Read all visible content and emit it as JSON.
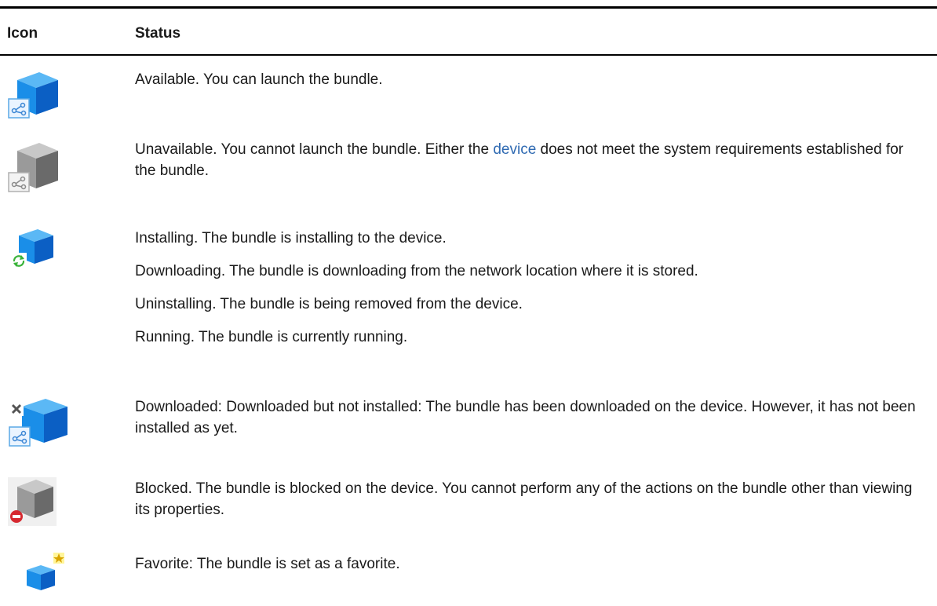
{
  "header": {
    "icon": "Icon",
    "status": "Status"
  },
  "rows": [
    {
      "icon": "blue-bundle-shortcut-icon",
      "lines": [
        "Available. You can launch the bundle."
      ]
    },
    {
      "icon": "gray-bundle-shortcut-icon",
      "lines": [
        "Unavailable. You cannot launch the bundle. Either the ",
        "device",
        " does not meet the system requirements established for the bundle."
      ]
    },
    {
      "icon": "blue-bundle-refresh-icon",
      "lines": [
        "Installing. The bundle is installing to the device.",
        "Downloading. The bundle is downloading from the network location where it is stored.",
        "Uninstalling. The bundle is being removed from the device.",
        "Running. The bundle is currently running."
      ]
    },
    {
      "icon": "blue-bundle-downloaded-icon",
      "lines": [
        "Downloaded: Downloaded but not installed: The bundle has been downloaded on the device. However, it has not been installed as yet."
      ]
    },
    {
      "icon": "gray-bundle-blocked-icon",
      "lines": [
        "Blocked. The bundle is blocked on the device. You cannot perform any of the actions on the bundle other than viewing its properties."
      ]
    },
    {
      "icon": "blue-bundle-favorite-icon",
      "lines": [
        "Favorite: The bundle is set as a favorite."
      ]
    }
  ],
  "colors": {
    "blue_top": "#5bb8f5",
    "blue_left": "#1a8ee8",
    "blue_right": "#0b5fc4",
    "gray_top": "#c8c8c8",
    "gray_left": "#9a9a9a",
    "gray_right": "#6a6a6a",
    "link": "#2f6ab2"
  }
}
